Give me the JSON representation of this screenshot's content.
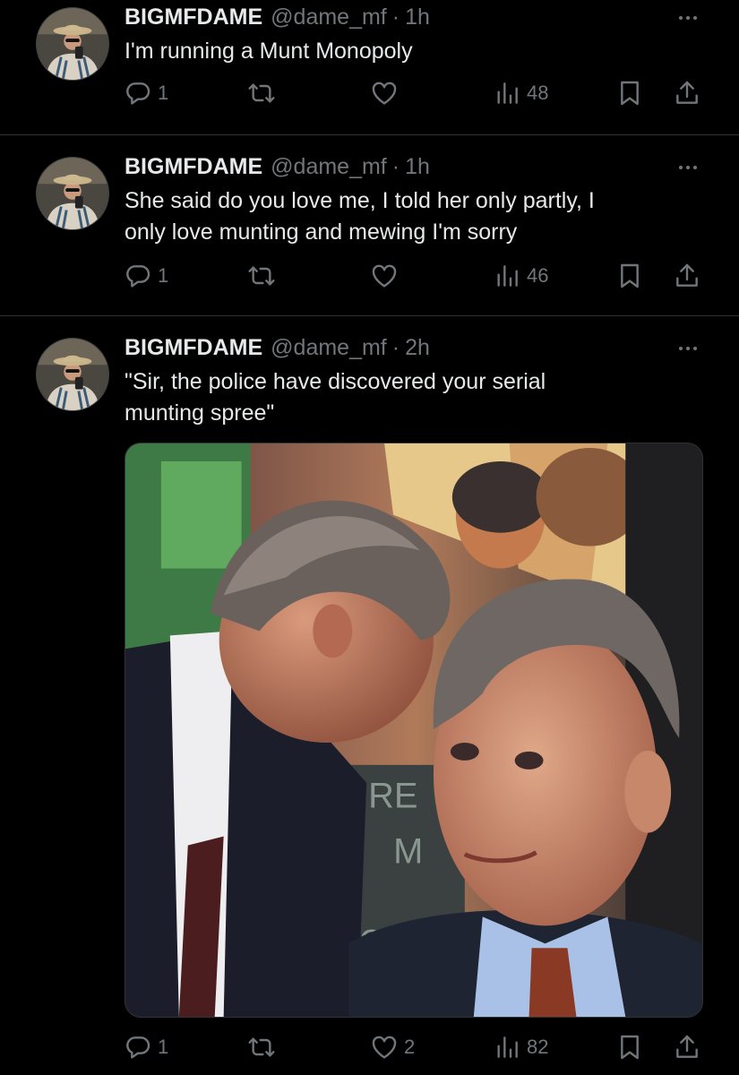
{
  "tweets": [
    {
      "name": "BIGMFDAME",
      "handle": "@dame_mf",
      "separator": "·",
      "time": "1h",
      "text": "I'm running a Munt Monopoly",
      "replies": "1",
      "retweets": "",
      "likes": "",
      "views": "48"
    },
    {
      "name": "BIGMFDAME",
      "handle": "@dame_mf",
      "separator": "·",
      "time": "1h",
      "text_lines": [
        "She said do you love me, I told her only partly, I",
        "only love munting and mewing I'm sorry"
      ],
      "replies": "1",
      "retweets": "",
      "likes": "",
      "views": "46"
    },
    {
      "name": "BIGMFDAME",
      "handle": "@dame_mf",
      "separator": "·",
      "time": "2h",
      "text_lines": [
        "\"Sir, the police have discovered your serial",
        "munting spree\""
      ],
      "media_image_text": "RE\nM\nCo",
      "replies": "1",
      "retweets": "",
      "likes": "2",
      "views": "82"
    }
  ],
  "icons": {
    "reply": "reply-icon",
    "retweet": "retweet-icon",
    "like": "heart-icon",
    "views": "views-bar-chart-icon",
    "bookmark": "bookmark-icon",
    "share": "share-icon",
    "more": "more-dots-icon"
  },
  "colors": {
    "background": "#000000",
    "text_primary": "#e7e9ea",
    "text_secondary": "#71767b",
    "divider": "#2f3336"
  }
}
